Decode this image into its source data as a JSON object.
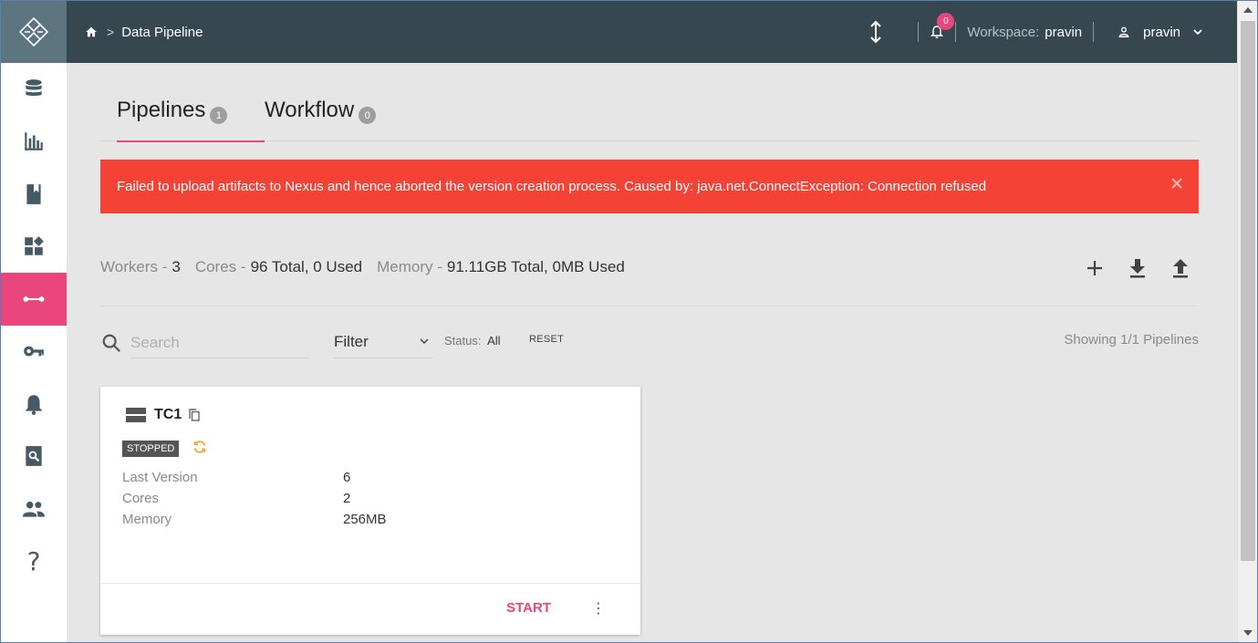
{
  "header": {
    "breadcrumb": "Data Pipeline",
    "notification_count": "0",
    "workspace_label": "Workspace:",
    "workspace_value": "pravin",
    "user_name": "pravin"
  },
  "sidebar": {
    "items": [
      {
        "icon": "database-icon"
      },
      {
        "icon": "bar-chart-icon"
      },
      {
        "icon": "book-icon"
      },
      {
        "icon": "dashboard-icon"
      },
      {
        "icon": "pipeline-icon",
        "active": true
      },
      {
        "icon": "key-icon"
      },
      {
        "icon": "bell-icon"
      },
      {
        "icon": "search-doc-icon"
      },
      {
        "icon": "users-icon"
      },
      {
        "icon": "help-icon",
        "label": "?"
      }
    ]
  },
  "tabs": [
    {
      "label": "Pipelines",
      "count": "1",
      "active": true
    },
    {
      "label": "Workflow",
      "count": "0",
      "active": false
    }
  ],
  "alert": {
    "message": "Failed to upload artifacts to Nexus and hence aborted the version creation process. Caused by: java.net.ConnectException: Connection refused",
    "close": "×"
  },
  "stats": {
    "workers_label": "Workers -",
    "workers_value": "3",
    "cores_label": "Cores -",
    "cores_value": "96 Total, 0 Used",
    "memory_label": "Memory -",
    "memory_value": "91.11GB Total, 0MB Used"
  },
  "toolbar": {
    "search_placeholder": "Search",
    "filter_label": "Filter",
    "status_label": "Status:",
    "status_value": "All",
    "reset_label": "RESET",
    "showing_text": "Showing 1/1 Pipelines"
  },
  "pipeline_card": {
    "name": "TC1",
    "status": "STOPPED",
    "fields": [
      {
        "label": "Last Version",
        "value": "6"
      },
      {
        "label": "Cores",
        "value": "2"
      },
      {
        "label": "Memory",
        "value": "256MB"
      }
    ],
    "start_label": "START",
    "more_icon": "⋮"
  },
  "colors": {
    "accent": "#e8467c",
    "header_bg": "#37474f",
    "alert_bg": "#f44336",
    "logo_bg": "#5d7580",
    "sync_icon": "#f5a623"
  }
}
